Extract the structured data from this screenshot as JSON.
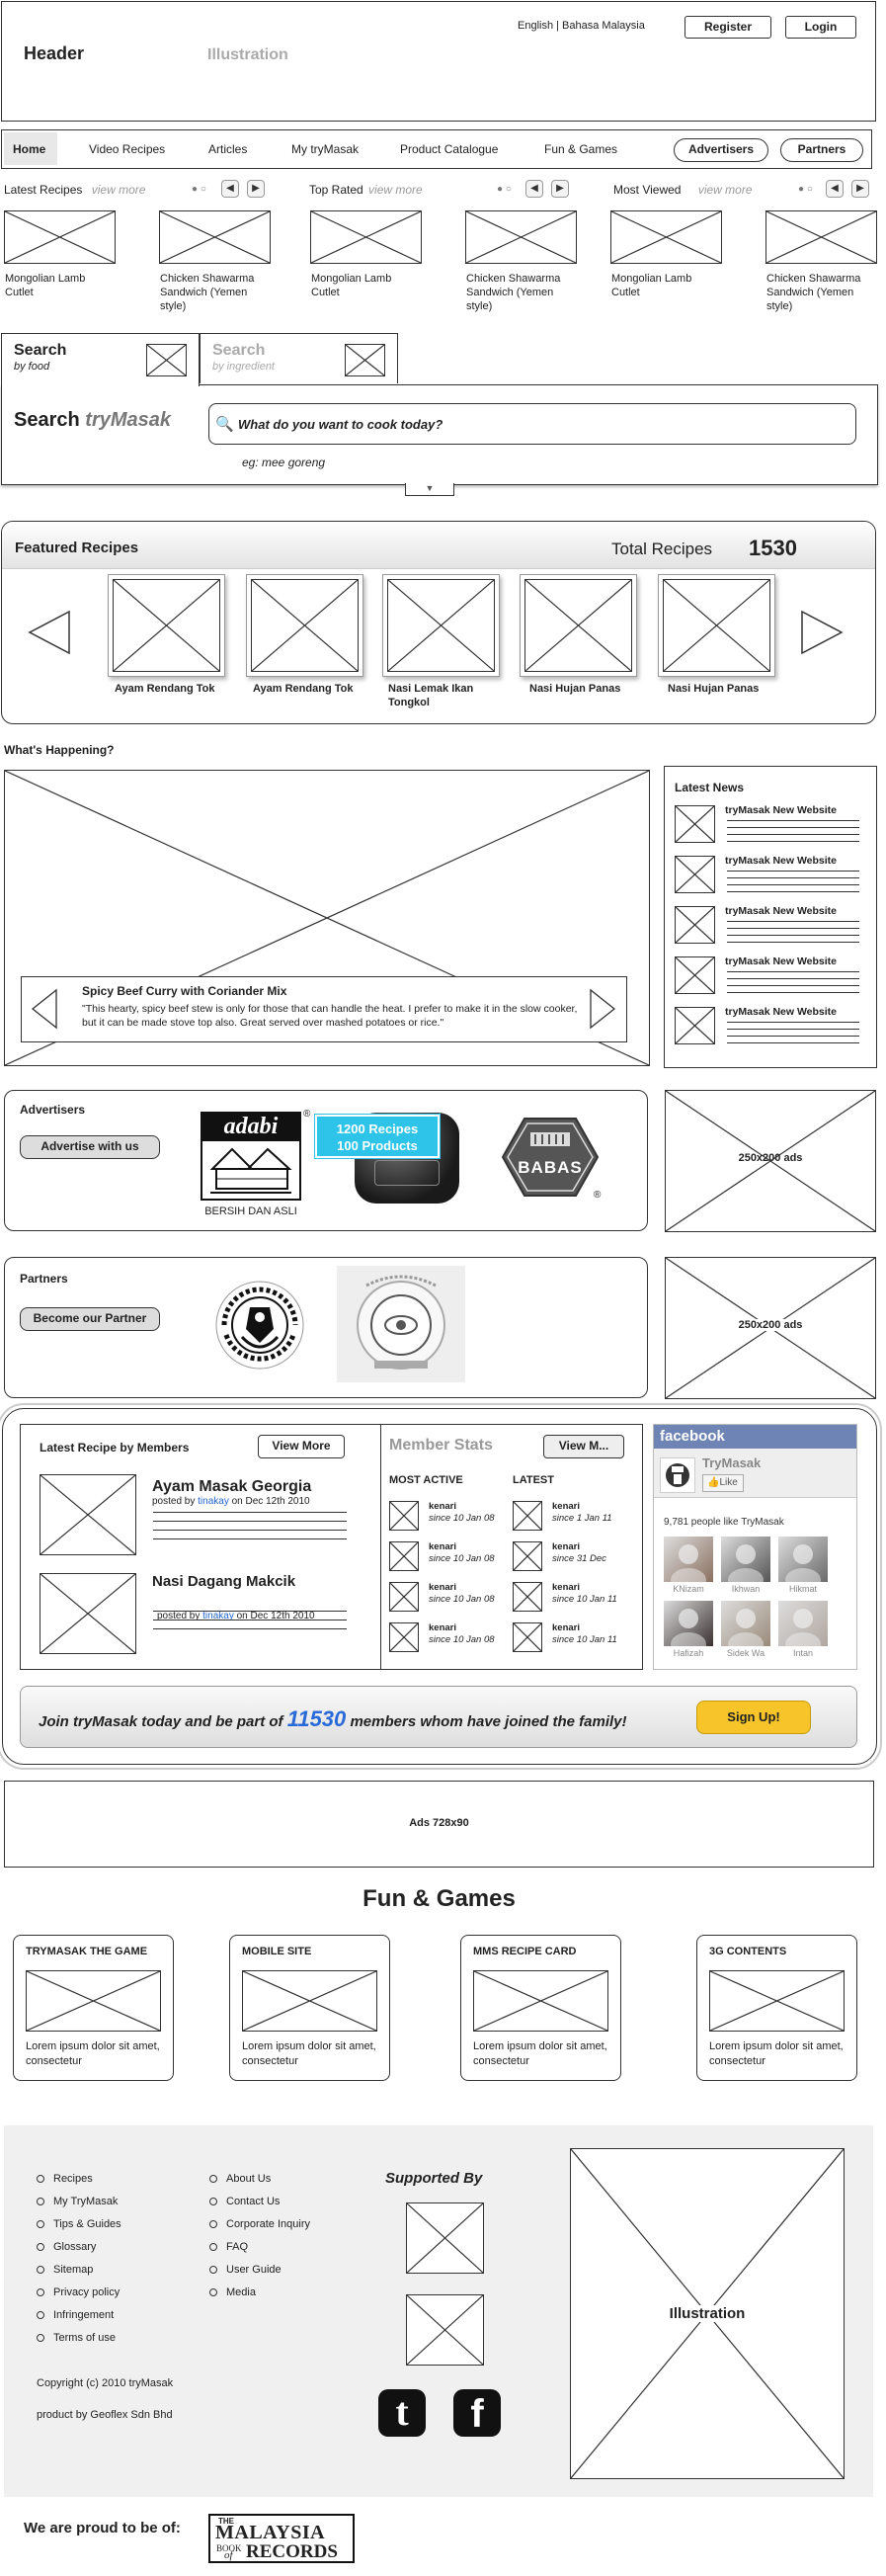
{
  "header": {
    "title": "Header",
    "illustration": "Illustration",
    "languages": "English | Bahasa Malaysia",
    "register": "Register",
    "login": "Login"
  },
  "nav": {
    "items": [
      "Home",
      "Video Recipes",
      "Articles",
      "My tryMasak",
      "Product Catalogue",
      "Fun & Games"
    ],
    "advertisers": "Advertisers",
    "partners": "Partners"
  },
  "strips": [
    {
      "title": "Latest Recipes",
      "more": "view more"
    },
    {
      "title": "Top Rated",
      "more": "view more"
    },
    {
      "title": "Most Viewed",
      "more": "view more"
    }
  ],
  "strip_items": [
    "Mongolian Lamb Cutlet",
    "Chicken Shawarma Sandwich (Yemen style)",
    "Mongolian Lamb Cutlet",
    "Chicken Shawarma Sandwich (Yemen style)",
    "Mongolian Lamb Cutlet",
    "Chicken Shawarma Sandwich (Yemen style)"
  ],
  "search": {
    "tab_food_title": "Search",
    "tab_food_sub": "by food",
    "tab_ing_title": "Search",
    "tab_ing_sub": "by ingredient",
    "label_prefix": "Search",
    "label_brand": "tryMasak",
    "placeholder": "What do you want to cook today?",
    "example": "eg: mee goreng"
  },
  "featured": {
    "title": "Featured Recipes",
    "total_label": "Total Recipes",
    "total": "1530",
    "items": [
      "Ayam Rendang Tok",
      "Ayam Rendang Tok",
      "Nasi Lemak Ikan Tongkol",
      "Nasi Hujan Panas",
      "Nasi Hujan Panas"
    ]
  },
  "happening": {
    "title": "What's Happening?",
    "caption_title": "Spicy Beef Curry with Coriander Mix",
    "caption_text": "\"This hearty, spicy beef stew is only for those that can handle the heat. I prefer to make it in the slow cooker, but it can be made stove top also. Great served over mashed potatoes or rice.\""
  },
  "latest_news": {
    "title": "Latest News",
    "items": [
      "tryMasak New Website",
      "tryMasak New Website",
      "tryMasak New Website",
      "tryMasak New Website",
      "tryMasak New Website"
    ]
  },
  "advertisers": {
    "title": "Advertisers",
    "button": "Advertise with us",
    "adabi_logo": "adabi",
    "adabi_tagline": "BERSIH DAN ASLI",
    "bubble_line1": "1200 Recipes",
    "bubble_line2": "100 Products",
    "babas": "BABAS",
    "ad": "250x200 ads"
  },
  "partners": {
    "title": "Partners",
    "button": "Become our Partner",
    "ad": "250x200 ads"
  },
  "members": {
    "latest_title": "Latest Recipe by Members",
    "view_more": "View More",
    "recipes": [
      {
        "title": "Ayam Masak Georgia",
        "posted": "posted by",
        "user": "tinakay",
        "date": "on Dec 12th 2010"
      },
      {
        "title": "Nasi Dagang Makcik",
        "posted": "posted by",
        "user": "tinakay",
        "date": "on Dec 12th 2010"
      }
    ],
    "stats_title": "Member Stats",
    "stats_view": "View M...",
    "most_active": "MOST ACTIVE",
    "latest": "LATEST",
    "active_rows": [
      {
        "name": "kenari",
        "since": "since 10 Jan 08"
      },
      {
        "name": "kenari",
        "since": "since 10 Jan 08"
      },
      {
        "name": "kenari",
        "since": "since 10 Jan 08"
      },
      {
        "name": "kenari",
        "since": "since 10 Jan 08"
      }
    ],
    "latest_rows": [
      {
        "name": "kenari",
        "since": "since 1 Jan 11"
      },
      {
        "name": "kenari",
        "since": "since 31 Dec"
      },
      {
        "name": "kenari",
        "since": "since 10 Jan 11"
      },
      {
        "name": "kenari",
        "since": "since 10 Jan 11"
      }
    ],
    "join_prefix": "Join tryMasak today and be part of",
    "join_count": "11530",
    "join_suffix": "members whom have joined the family!",
    "signup": "Sign Up!"
  },
  "facebook": {
    "brand": "facebook",
    "page": "TryMasak",
    "like": "Like",
    "likes_text": "9,781 people like TryMasak",
    "people": [
      "KNizam",
      "Ikhwan",
      "Hikmat",
      "Hafizah",
      "Sidek Wa",
      "Intan"
    ]
  },
  "ads728": "Ads 728x90",
  "fun": {
    "title": "Fun & Games",
    "cards": [
      {
        "title": "TRYMASAK THE GAME",
        "text": "Lorem ipsum dolor sit amet, consectetur"
      },
      {
        "title": "MOBILE SITE",
        "text": "Lorem ipsum dolor sit amet, consectetur"
      },
      {
        "title": "MMS RECIPE CARD",
        "text": "Lorem ipsum dolor sit amet, consectetur"
      },
      {
        "title": "3G CONTENTS",
        "text": "Lorem ipsum dolor sit amet, consectetur"
      }
    ]
  },
  "footer": {
    "col1": [
      "Recipes",
      "My TryMasak",
      "Tips & Guides",
      "Glossary",
      "Sitemap",
      "Privacy policy",
      "Infringement",
      "Terms of use"
    ],
    "col2": [
      "About Us",
      "Contact Us",
      "Corporate Inquiry",
      "FAQ",
      "User Guide",
      "Media"
    ],
    "supported_by": "Supported By",
    "illustration": "Illustration",
    "copyright": "Copyright (c) 2010 tryMasak",
    "product_by": "product by Geoflex Sdn Bhd",
    "proud": "We are proud to be of:",
    "mbr_the": "THE",
    "mbr_malaysia": "MALAYSIA",
    "mbr_book": "BOOK",
    "mbr_of": "of",
    "mbr_records": "RECORDS"
  }
}
